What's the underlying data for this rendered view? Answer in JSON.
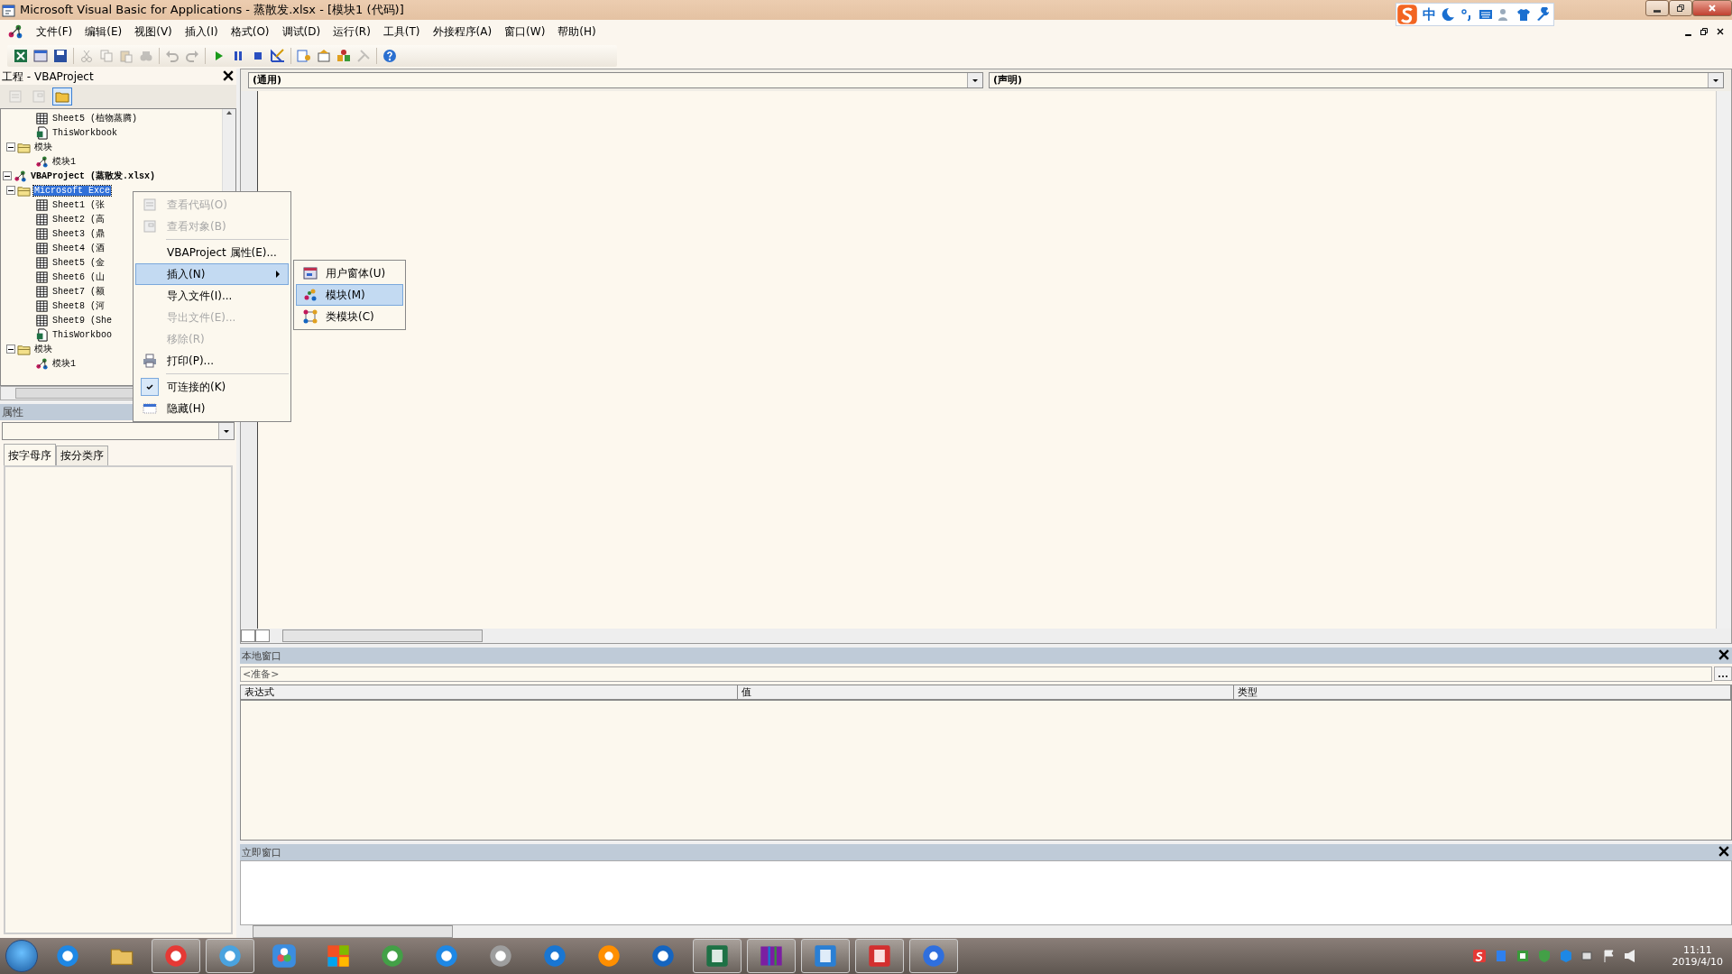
{
  "window": {
    "title": "Microsoft Visual Basic for Applications - 蒸散发.xlsx - [模块1 (代码)]"
  },
  "ime_bar": {
    "mode": "中"
  },
  "menu": [
    "文件(F)",
    "编辑(E)",
    "视图(V)",
    "插入(I)",
    "格式(O)",
    "调试(D)",
    "运行(R)",
    "工具(T)",
    "外接程序(A)",
    "窗口(W)",
    "帮助(H)"
  ],
  "toolbar": [
    {
      "kind": "sheet",
      "disabled": false
    },
    {
      "kind": "form",
      "disabled": false
    },
    {
      "kind": "save",
      "disabled": false
    },
    {
      "kind": "sep"
    },
    {
      "kind": "cut",
      "disabled": true
    },
    {
      "kind": "copy",
      "disabled": true
    },
    {
      "kind": "paste",
      "disabled": true
    },
    {
      "kind": "find",
      "disabled": true
    },
    {
      "kind": "sep"
    },
    {
      "kind": "undo",
      "disabled": true
    },
    {
      "kind": "redo",
      "disabled": true
    },
    {
      "kind": "sep"
    },
    {
      "kind": "run",
      "disabled": false
    },
    {
      "kind": "pause",
      "disabled": false
    },
    {
      "kind": "stop",
      "disabled": false
    },
    {
      "kind": "design",
      "disabled": false
    },
    {
      "kind": "sep"
    },
    {
      "kind": "explorer",
      "disabled": false
    },
    {
      "kind": "props",
      "disabled": false
    },
    {
      "kind": "browser",
      "disabled": false
    },
    {
      "kind": "toolbox",
      "disabled": true
    },
    {
      "kind": "sep"
    },
    {
      "kind": "help",
      "disabled": false
    }
  ],
  "project_pane": {
    "title": "工程 - VBAProject",
    "tree": [
      {
        "kind": "continuation",
        "children": [
          {
            "kind": "continuation",
            "children": [
              {
                "kind": "sheet",
                "label": "Sheet5 (植物蒸腾)",
                "selected": false
              },
              {
                "kind": "workbook",
                "label": "ThisWorkbook",
                "selected": false
              }
            ]
          },
          {
            "kind": "folder",
            "label": "模块",
            "expanded": true,
            "selected": false,
            "children": [
              {
                "kind": "module",
                "label": "模块1",
                "selected": false
              }
            ]
          }
        ]
      },
      {
        "kind": "project",
        "label": "VBAProject (蒸散发.xlsx)",
        "expanded": true,
        "selected": false,
        "children": [
          {
            "kind": "folder",
            "label": "Microsoft Exce",
            "expanded": true,
            "selected": true,
            "children": [
              {
                "kind": "sheet",
                "label": "Sheet1 (张",
                "selected": false
              },
              {
                "kind": "sheet",
                "label": "Sheet2 (高",
                "selected": false
              },
              {
                "kind": "sheet",
                "label": "Sheet3 (鼎",
                "selected": false
              },
              {
                "kind": "sheet",
                "label": "Sheet4 (酒",
                "selected": false
              },
              {
                "kind": "sheet",
                "label": "Sheet5 (金",
                "selected": false
              },
              {
                "kind": "sheet",
                "label": "Sheet6 (山",
                "selected": false
              },
              {
                "kind": "sheet",
                "label": "Sheet7 (额",
                "selected": false
              },
              {
                "kind": "sheet",
                "label": "Sheet8 (河",
                "selected": false
              },
              {
                "kind": "sheet",
                "label": "Sheet9 (She",
                "selected": false
              },
              {
                "kind": "workbook",
                "label": "ThisWorkboo",
                "selected": false
              }
            ]
          },
          {
            "kind": "folder",
            "label": "模块",
            "expanded": true,
            "selected": false,
            "children": [
              {
                "kind": "module",
                "label": "模块1",
                "selected": false
              }
            ]
          }
        ]
      }
    ]
  },
  "properties_pane": {
    "title": "属性",
    "tabs": [
      {
        "label": "按字母序",
        "selected": true
      },
      {
        "label": "按分类序",
        "selected": false
      }
    ]
  },
  "code_window": {
    "object_box": "(通用)",
    "procedure_box": "(声明)"
  },
  "context_menu": [
    {
      "kind": "code",
      "label": "查看代码(O)",
      "disabled": true,
      "selected": false
    },
    {
      "kind": "object",
      "label": "查看对象(B)",
      "disabled": true,
      "selected": false
    },
    {
      "kind": "separator"
    },
    {
      "kind": "plain",
      "label": "VBAProject 属性(E)...",
      "disabled": false,
      "selected": false
    },
    {
      "kind": "submenu",
      "label": "插入(N)",
      "disabled": false,
      "selected": true
    },
    {
      "kind": "plain",
      "label": "导入文件(I)...",
      "disabled": false,
      "selected": false
    },
    {
      "kind": "plain",
      "label": "导出文件(E)...",
      "disabled": true,
      "selected": false
    },
    {
      "kind": "plain",
      "label": "移除(R)",
      "disabled": true,
      "selected": false
    },
    {
      "kind": "print",
      "label": "打印(P)...",
      "disabled": false,
      "selected": false
    },
    {
      "kind": "separator"
    },
    {
      "kind": "check",
      "label": "可连接的(K)",
      "disabled": false,
      "selected": false,
      "checked": true
    },
    {
      "kind": "hide",
      "label": "隐藏(H)",
      "disabled": false,
      "selected": false
    }
  ],
  "submenu": [
    {
      "kind": "userform",
      "label": "用户窗体(U)",
      "selected": false
    },
    {
      "kind": "module",
      "label": "模块(M)",
      "selected": true
    },
    {
      "kind": "classmodule",
      "label": "类模块(C)",
      "selected": false
    }
  ],
  "locals_window": {
    "title": "本地窗口",
    "context": "<准备>",
    "columns": [
      "表达式",
      "值",
      "类型"
    ]
  },
  "immediate_window": {
    "title": "立即窗口"
  },
  "taskbar": {
    "apps": [
      {
        "kind": "ring",
        "color": "#1e88e5",
        "running": false
      },
      {
        "kind": "folder",
        "color": "#e8c060",
        "running": false
      },
      {
        "kind": "ring",
        "color": "#e53935",
        "running": true
      },
      {
        "kind": "ring",
        "color": "#4aa3df",
        "running": true
      },
      {
        "kind": "petals",
        "color": "#3b8de0",
        "running": false
      },
      {
        "kind": "tiles",
        "color": "#f25022",
        "running": false
      },
      {
        "kind": "ring",
        "color": "#43a047",
        "running": false
      },
      {
        "kind": "ring",
        "color": "#1e88e5",
        "running": false
      },
      {
        "kind": "ring",
        "color": "#9e9e9e",
        "running": false
      },
      {
        "kind": "disc",
        "color": "#1976d2",
        "running": false
      },
      {
        "kind": "disc",
        "color": "#ff8f00",
        "running": false
      },
      {
        "kind": "ring",
        "color": "#1565c0",
        "running": false
      },
      {
        "kind": "square",
        "color": "#1e7145",
        "running": true
      },
      {
        "kind": "books",
        "color": "#7b1fa2",
        "running": true
      },
      {
        "kind": "square",
        "color": "#2a7fd4",
        "running": true
      },
      {
        "kind": "square",
        "color": "#d32f2f",
        "running": true
      },
      {
        "kind": "disc",
        "color": "#2f6fde",
        "running": true
      }
    ],
    "time": "11:11",
    "date": "2019/4/10"
  }
}
